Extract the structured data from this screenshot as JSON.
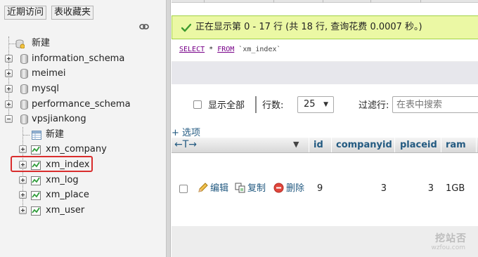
{
  "nav": {
    "tabs": {
      "recent": "近期访问",
      "favorites": "表收藏夹"
    },
    "tree": [
      {
        "label": "新建",
        "kind": "new"
      },
      {
        "label": "information_schema",
        "kind": "database",
        "expanded": false
      },
      {
        "label": "meimei",
        "kind": "database",
        "expanded": false
      },
      {
        "label": "mysql",
        "kind": "database",
        "expanded": false
      },
      {
        "label": "performance_schema",
        "kind": "database",
        "expanded": false
      },
      {
        "label": "vpsjiankong",
        "kind": "database",
        "expanded": true,
        "children": [
          {
            "label": "新建",
            "kind": "new"
          },
          {
            "label": "xm_company",
            "kind": "table"
          },
          {
            "label": "xm_index",
            "kind": "table",
            "highlighted": true
          },
          {
            "label": "xm_log",
            "kind": "table"
          },
          {
            "label": "xm_place",
            "kind": "table"
          },
          {
            "label": "xm_user",
            "kind": "table"
          }
        ]
      }
    ]
  },
  "main": {
    "success_message": "正在显示第 0 - 17 行 (共 18 行, 查询花费 0.0007 秒。)",
    "sql": {
      "select": "SELECT",
      "rest": " * ",
      "from": "FROM",
      "table": " `xm_index`"
    },
    "controls": {
      "show_all": "显示全部",
      "rows_label": "行数:",
      "rows_value": "25",
      "filter_label": "过滤行:",
      "filter_placeholder": "在表中搜索"
    },
    "options_link": "+ 选项",
    "table": {
      "columns": [
        "id",
        "companyid",
        "placeid",
        "ram"
      ],
      "actions": {
        "edit": "编辑",
        "copy": "复制",
        "delete": "删除"
      },
      "rows": [
        {
          "id": "9",
          "companyid": "3",
          "placeid": "3",
          "ram": "1GB"
        }
      ]
    }
  },
  "watermark": {
    "title": "挖站否",
    "url": "wzfou.com"
  },
  "colors": {
    "success_bg": "#ebf8a4",
    "success_border": "#a2d246",
    "link": "#235a81",
    "sql_keyword": "#770088",
    "highlight_box": "#d92d2d"
  }
}
